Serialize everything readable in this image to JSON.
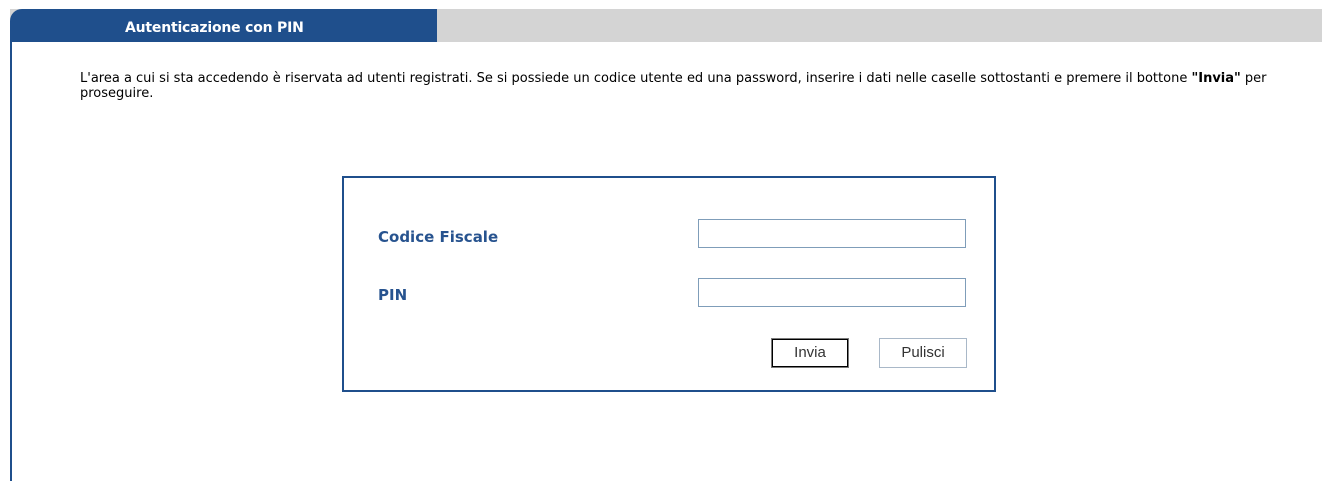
{
  "header": {
    "tab_title": "Autenticazione con PIN"
  },
  "intro": {
    "text_before": "L'area a cui si sta accedendo è riservata ad utenti registrati. Se si possiede un codice utente ed una password, inserire i dati nelle caselle sottostanti e premere il bottone ",
    "highlight": "\"Invia\"",
    "text_after": " per proseguire."
  },
  "form": {
    "codice_fiscale_label": "Codice Fiscale",
    "codice_fiscale_value": "",
    "pin_label": "PIN",
    "pin_value": "",
    "submit_label": "Invia",
    "clear_label": "Pulisci"
  },
  "colors": {
    "brand_blue": "#1f4f8c",
    "label_blue": "#27538f",
    "tab_gray": "#d4d4d4"
  }
}
